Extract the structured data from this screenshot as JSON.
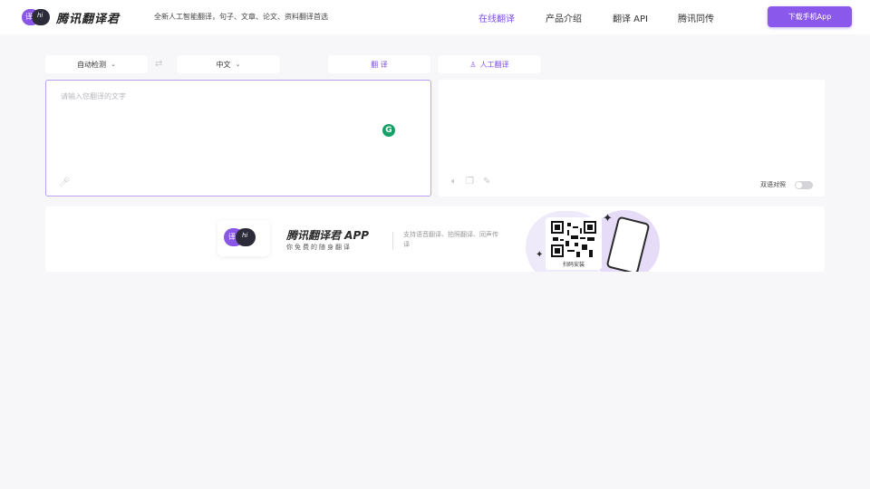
{
  "header": {
    "logo_text": "腾讯翻译君",
    "slogan": "全新人工智能翻译，句子、文章、论文、资料翻译首选",
    "nav": [
      {
        "label": "在线翻译",
        "active": true
      },
      {
        "label": "产品介绍",
        "active": false
      },
      {
        "label": "翻译 API",
        "active": false
      },
      {
        "label": "腾讯同传",
        "active": false
      }
    ],
    "download_label": "下载手机App"
  },
  "toolbar": {
    "source_lang": "自动检测",
    "target_lang": "中文",
    "translate_label": "翻 译",
    "human_translate_label": "人工翻译"
  },
  "source": {
    "placeholder": "请输入您翻译的文字"
  },
  "target": {
    "compare_label": "双语对照",
    "compare_enabled": false
  },
  "banner": {
    "app_title": "腾讯翻译君 APP",
    "app_subtitle": "你免费的随身翻译",
    "features": "支持语音翻译、拍照翻译、同声传译",
    "scan_label": "扫码安装"
  },
  "colors": {
    "accent": "#8a58ea",
    "background": "#f7f7f9"
  },
  "icons": [
    "logo-icon",
    "chevron-down-icon",
    "swap-icon",
    "grammarly-icon",
    "microphone-icon",
    "speaker-icon",
    "copy-icon",
    "edit-icon",
    "qr-code-icon",
    "phone-icon",
    "sparkle-icon"
  ]
}
